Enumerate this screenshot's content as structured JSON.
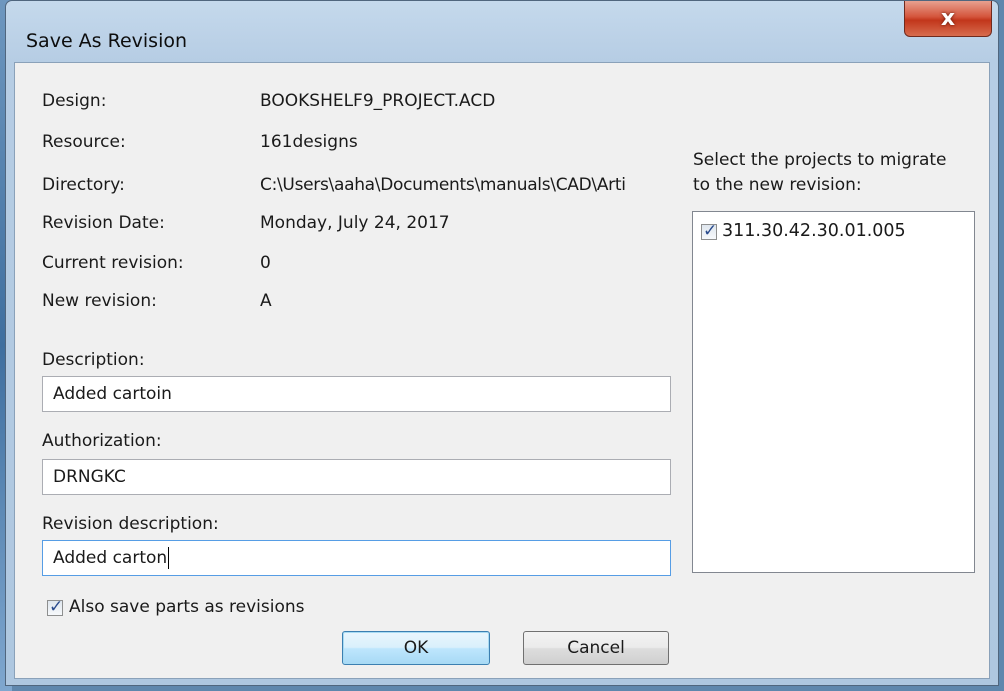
{
  "window": {
    "title": "Save As Revision",
    "close_glyph": "x"
  },
  "info": {
    "design_label": "Design:",
    "design_value": "BOOKSHELF9_PROJECT.ACD",
    "resource_label": "Resource:",
    "resource_value": "161designs",
    "directory_label": "Directory:",
    "directory_value": "C:\\Users\\aaha\\Documents\\manuals\\CAD\\Arti",
    "revision_date_label": "Revision Date:",
    "revision_date_value": "Monday, July 24, 2017",
    "current_revision_label": "Current revision:",
    "current_revision_value": "0",
    "new_revision_label": "New revision:",
    "new_revision_value": "A"
  },
  "form": {
    "description_label": "Description:",
    "description_value": "Added cartoin",
    "authorization_label": "Authorization:",
    "authorization_value": "DRNGKC",
    "revision_description_label": "Revision description:",
    "revision_description_value": "Added carton"
  },
  "projects": {
    "prompt_line1": "Select the projects to migrate",
    "prompt_line2": "to the new revision:",
    "items": [
      {
        "label": "311.30.42.30.01.005",
        "checked": true
      }
    ]
  },
  "options": {
    "save_parts_label": "Also save parts as revisions",
    "save_parts_checked": true
  },
  "buttons": {
    "ok_label": "OK",
    "cancel_label": "Cancel"
  },
  "colors": {
    "title_bar": "#b9d1ea",
    "close_button": "#c7452a",
    "client_bg": "#f0f0f0",
    "focus_border": "#569de5"
  }
}
